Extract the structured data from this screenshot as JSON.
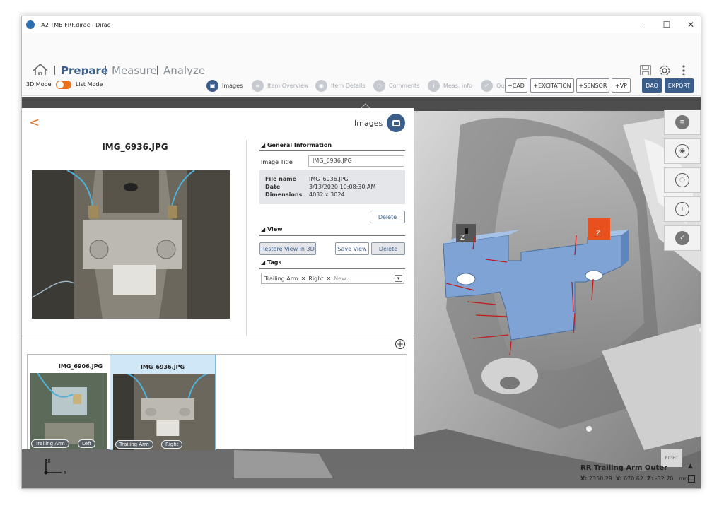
{
  "window": {
    "title": "TA2 TMB FRF.dirac - Dirac",
    "controls": {
      "minimize": "–",
      "maximize": "☐",
      "close": "✕"
    }
  },
  "nav": {
    "items": [
      {
        "label": "Prepare",
        "active": true
      },
      {
        "label": "Measure",
        "active": false
      },
      {
        "label": "Analyze",
        "active": false
      }
    ],
    "icons": [
      "home-icon",
      "save-icon",
      "gear-icon",
      "more-vertical-icon"
    ]
  },
  "toolbar": {
    "mode_3d": "3D Mode",
    "mode_list": "List Mode",
    "tabs": [
      {
        "label": "Images",
        "active": true,
        "icon": "image-icon"
      },
      {
        "label": "Item Overview",
        "active": false,
        "icon": "list-icon"
      },
      {
        "label": "Item Details",
        "active": false,
        "icon": "eye-icon"
      },
      {
        "label": "Comments",
        "active": false,
        "icon": "comment-icon"
      },
      {
        "label": "Meas. info",
        "active": false,
        "icon": "info-icon"
      },
      {
        "label": "Qu",
        "active": false,
        "icon": "check-icon"
      }
    ],
    "add_buttons": [
      "+CAD",
      "+EXCITATION",
      "+SENSOR",
      "+VP"
    ],
    "daq": "DAQ",
    "export": "EXPORT"
  },
  "panel": {
    "back": "<",
    "title": "Images",
    "image_name": "IMG_6936.JPG",
    "general": {
      "header": "General Information",
      "image_title_label": "Image Title",
      "image_title_value": "IMG_6936.JPG",
      "file_name_label": "File name",
      "file_name_value": "IMG_6936.JPG",
      "date_label": "Date",
      "date_value": "3/13/2020 10:08:30 AM",
      "dimensions_label": "Dimensions",
      "dimensions_value": "4032 x 3024",
      "delete": "Delete"
    },
    "view": {
      "header": "View",
      "restore": "Restore View in 3D",
      "save": "Save View",
      "delete": "Delete"
    },
    "tags": {
      "header": "Tags",
      "items": [
        "Trailing Arm",
        "Right"
      ],
      "remove": "✕",
      "placeholder": "New..."
    },
    "add": "+"
  },
  "gallery": [
    {
      "name": "IMG_6906.JPG",
      "tags": [
        "Trailing Arm",
        "Left"
      ],
      "selected": false
    },
    {
      "name": "IMG_6936.JPG",
      "tags": [
        "Trailing Arm",
        "Right"
      ],
      "selected": true
    }
  ],
  "viewport": {
    "item_label": "RR Trailing Arm Outer",
    "x_label": "X:",
    "x_value": "2350.29",
    "y_label": "Y:",
    "y_value": "670.62",
    "z_label": "Z:",
    "z_value": "-32.70",
    "unit": "mm",
    "cube_label": "RIGHT",
    "axis_x": "X",
    "axis_y": "Y",
    "marker_z": "Z",
    "side_icons": [
      "list-icon",
      "eye-icon",
      "comment-icon",
      "info-icon",
      "check-icon"
    ]
  },
  "colors": {
    "accent": "#e8701e",
    "primary": "#3a5d8a",
    "part_blue": "#7ea3d4"
  }
}
